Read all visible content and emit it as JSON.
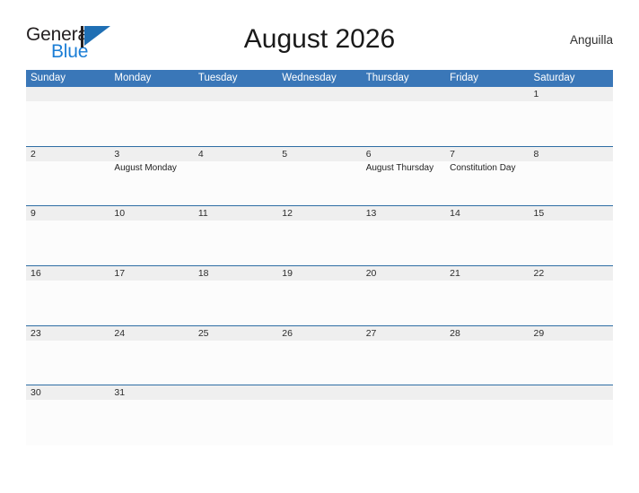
{
  "brand": {
    "name_part1": "General",
    "name_part2": "Blue",
    "flag_icon": "flag-icon",
    "accent_blue": "#1b7ed6",
    "dark": "#231f20"
  },
  "header": {
    "title": "August 2026",
    "region": "Anguilla"
  },
  "theme": {
    "header_row_blue": "#3a77b8",
    "row_divider_blue": "#2e6da4",
    "date_band_gray": "#efefef",
    "cell_background": "#fcfcfc",
    "page_background": "#ffffff"
  },
  "calendar": {
    "month": "August",
    "year": "2026",
    "weekdays": [
      "Sunday",
      "Monday",
      "Tuesday",
      "Wednesday",
      "Thursday",
      "Friday",
      "Saturday"
    ],
    "weeks": [
      {
        "days": [
          {
            "num": "",
            "events": []
          },
          {
            "num": "",
            "events": []
          },
          {
            "num": "",
            "events": []
          },
          {
            "num": "",
            "events": []
          },
          {
            "num": "",
            "events": []
          },
          {
            "num": "",
            "events": []
          },
          {
            "num": "1",
            "events": []
          }
        ]
      },
      {
        "days": [
          {
            "num": "2",
            "events": []
          },
          {
            "num": "3",
            "events": [
              "August Monday"
            ]
          },
          {
            "num": "4",
            "events": []
          },
          {
            "num": "5",
            "events": []
          },
          {
            "num": "6",
            "events": [
              "August Thursday"
            ]
          },
          {
            "num": "7",
            "events": [
              "Constitution Day"
            ]
          },
          {
            "num": "8",
            "events": []
          }
        ]
      },
      {
        "days": [
          {
            "num": "9",
            "events": []
          },
          {
            "num": "10",
            "events": []
          },
          {
            "num": "11",
            "events": []
          },
          {
            "num": "12",
            "events": []
          },
          {
            "num": "13",
            "events": []
          },
          {
            "num": "14",
            "events": []
          },
          {
            "num": "15",
            "events": []
          }
        ]
      },
      {
        "days": [
          {
            "num": "16",
            "events": []
          },
          {
            "num": "17",
            "events": []
          },
          {
            "num": "18",
            "events": []
          },
          {
            "num": "19",
            "events": []
          },
          {
            "num": "20",
            "events": []
          },
          {
            "num": "21",
            "events": []
          },
          {
            "num": "22",
            "events": []
          }
        ]
      },
      {
        "days": [
          {
            "num": "23",
            "events": []
          },
          {
            "num": "24",
            "events": []
          },
          {
            "num": "25",
            "events": []
          },
          {
            "num": "26",
            "events": []
          },
          {
            "num": "27",
            "events": []
          },
          {
            "num": "28",
            "events": []
          },
          {
            "num": "29",
            "events": []
          }
        ]
      },
      {
        "days": [
          {
            "num": "30",
            "events": []
          },
          {
            "num": "31",
            "events": []
          },
          {
            "num": "",
            "events": []
          },
          {
            "num": "",
            "events": []
          },
          {
            "num": "",
            "events": []
          },
          {
            "num": "",
            "events": []
          },
          {
            "num": "",
            "events": []
          }
        ]
      }
    ]
  }
}
